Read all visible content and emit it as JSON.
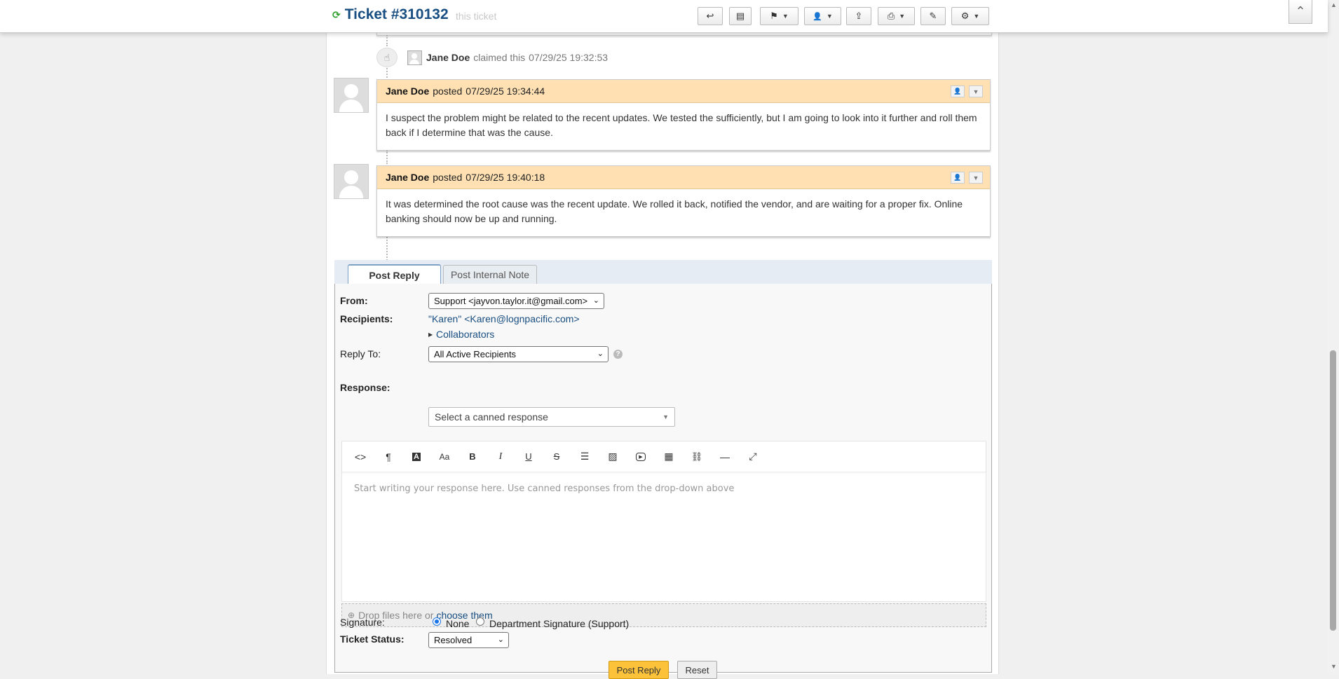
{
  "header": {
    "title": "Ticket #310132",
    "behind_text": "this ticket",
    "toolbar": [
      {
        "name": "reply-icon",
        "glyph": "↩"
      },
      {
        "name": "note-icon",
        "glyph": "▤"
      },
      {
        "name": "flag-icon",
        "glyph": "⚑"
      },
      {
        "name": "assign-user-icon",
        "glyph": "👤"
      },
      {
        "name": "transfer-icon",
        "glyph": "⇪"
      },
      {
        "name": "print-icon",
        "glyph": "⎙"
      },
      {
        "name": "edit-icon",
        "glyph": "✎"
      },
      {
        "name": "settings-gear-icon",
        "glyph": "⚙"
      }
    ]
  },
  "event": {
    "name": "Jane Doe",
    "verb": "claimed this",
    "timestamp": "07/29/25 19:32:53"
  },
  "entries": [
    {
      "name": "Jane Doe",
      "verb": "posted",
      "timestamp": "07/29/25 19:34:44",
      "body": "I suspect the problem might be related to the recent updates. We tested the sufficiently, but I am going to look into it further and roll them back if I determine that was the cause."
    },
    {
      "name": "Jane Doe",
      "verb": "posted",
      "timestamp": "07/29/25 19:40:18",
      "body": "It was determined the root cause was the recent update. We rolled it back, notified the vendor, and are waiting for a proper fix. Online banking should now be up and running."
    }
  ],
  "reply": {
    "tabs": [
      "Post Reply",
      "Post Internal Note"
    ],
    "from_label": "From:",
    "from_value": "Support <jayvon.taylor.it@gmail.com>",
    "recipients_label": "Recipients:",
    "recipients_value": "\"Karen\" <Karen@lognpacific.com>",
    "collaborators_label": "Collaborators",
    "reply_to_label": "Reply To:",
    "reply_to_value": "All Active Recipients",
    "response_label": "Response:",
    "canned_placeholder": "Select a canned response",
    "editor_placeholder": "Start writing your response here. Use canned responses from the drop-down above",
    "drop_text": "Drop files here or",
    "choose_text": "choose them",
    "signature_label": "Signature:",
    "signature_options": [
      "None",
      "Department Signature (Support)"
    ],
    "signature_selected": "None",
    "status_label": "Ticket Status:",
    "status_value": "Resolved",
    "submit_label": "Post Reply",
    "reset_label": "Reset"
  },
  "editor_tools": [
    {
      "name": "code-view-icon",
      "glyph": "<>"
    },
    {
      "name": "paragraph-icon",
      "glyph": "¶"
    },
    {
      "name": "text-color-icon",
      "glyph": "A"
    },
    {
      "name": "font-size-icon",
      "glyph": "Aa"
    },
    {
      "name": "bold-icon",
      "glyph": "B"
    },
    {
      "name": "italic-icon",
      "glyph": "I"
    },
    {
      "name": "underline-icon",
      "glyph": "U"
    },
    {
      "name": "strikethrough-icon",
      "glyph": "S"
    },
    {
      "name": "list-icon",
      "glyph": "☰"
    },
    {
      "name": "image-icon",
      "glyph": "▨"
    },
    {
      "name": "video-icon",
      "glyph": "▶"
    },
    {
      "name": "table-icon",
      "glyph": "▦"
    },
    {
      "name": "link-icon",
      "glyph": "⛓"
    },
    {
      "name": "horizontal-rule-icon",
      "glyph": "—"
    },
    {
      "name": "fullscreen-icon",
      "glyph": "⤢"
    }
  ],
  "colors": {
    "accent": "#184e81",
    "entry_header": "#ffe0b3",
    "primary_button": "#fcc23a"
  }
}
